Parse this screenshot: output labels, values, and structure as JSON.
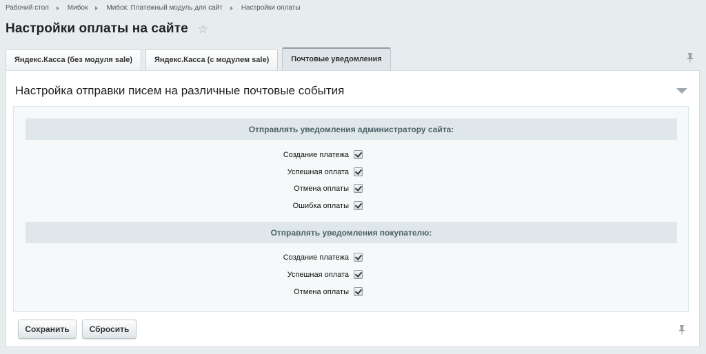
{
  "breadcrumb": [
    "Рабочий стол",
    "Мибок",
    "Мибок: Платежный модуль для сайт",
    "Настройки оплаты"
  ],
  "page_title": "Настройки оплаты на сайте",
  "tabs": [
    {
      "label": "Яндекс.Касса (без модуля sale)",
      "active": false
    },
    {
      "label": "Яндекс.Касса (с модулем sale)",
      "active": false
    },
    {
      "label": "Почтовые уведомления",
      "active": true
    }
  ],
  "panel": {
    "header": "Настройка отправки писем на различные почтовые события",
    "sections": [
      {
        "title": "Отправлять уведомления администратору сайта:",
        "items": [
          {
            "label": "Создание платежа",
            "checked": true
          },
          {
            "label": "Успешная оплата",
            "checked": true
          },
          {
            "label": "Отмена оплаты",
            "checked": true
          },
          {
            "label": "Ошибка оплаты",
            "checked": true
          }
        ]
      },
      {
        "title": "Отправлять уведомления покупателю:",
        "items": [
          {
            "label": "Создание платежа",
            "checked": true
          },
          {
            "label": "Успешная оплата",
            "checked": true
          },
          {
            "label": "Отмена оплаты",
            "checked": true
          }
        ]
      }
    ]
  },
  "buttons": {
    "save": "Сохранить",
    "reset": "Сбросить"
  },
  "icons": {
    "favorite": "star-icon",
    "pin": "pin-icon",
    "collapse": "chevron-down-icon"
  }
}
